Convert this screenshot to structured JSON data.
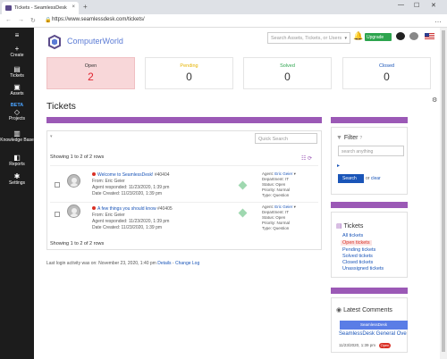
{
  "browser": {
    "tab_title": "Tickets - SeamlessDesk",
    "tab_close": "×",
    "new_tab": "+",
    "url": "https://www.seamlessdesk.com/tickets/",
    "back": "←",
    "forward": "→",
    "reload": "↻",
    "lock": "🔒",
    "menu": "…",
    "minimize": "—",
    "maximize": "☐",
    "close": "✕"
  },
  "sidebar": {
    "items": [
      {
        "label": "Create",
        "icon": "plus-icon",
        "glyph": "+"
      },
      {
        "label": "Tickets",
        "icon": "tickets-icon",
        "glyph": "▤"
      },
      {
        "label": "Assets",
        "icon": "assets-icon",
        "glyph": "▣"
      },
      {
        "label": "Projects",
        "icon": "projects-icon",
        "glyph": "◇",
        "badge": "BETA"
      },
      {
        "label": "Knowledge Base",
        "icon": "book-icon",
        "glyph": "▥"
      },
      {
        "label": "Reports",
        "icon": "reports-icon",
        "glyph": "◧"
      },
      {
        "label": "Settings",
        "icon": "gear-icon",
        "glyph": "✱"
      }
    ]
  },
  "header": {
    "brand": "ComputerWorld",
    "search_placeholder": "Search Assets, Tickets, or Users",
    "search_caret": "▾",
    "bell": "🔔",
    "upgrade_label": "Upgrade"
  },
  "stats": [
    {
      "label": "Open",
      "value": "2",
      "color": "#e0242f"
    },
    {
      "label": "Pending",
      "value": "0",
      "color": "#e5b300"
    },
    {
      "label": "Solved",
      "value": "0",
      "color": "#2da44e"
    },
    {
      "label": "Closed",
      "value": "0",
      "color": "#1a55b8"
    }
  ],
  "page": {
    "title": "Tickets",
    "quick_search_placeholder": "Quick Search",
    "filter_caret": "▾",
    "view_icons": "☷ ⟳",
    "showing_top": "Showing 1 to 2 of 2 rows",
    "showing_bottom": "Showing 1 to 2 of 2 rows"
  },
  "tickets": [
    {
      "title": "Welcome to SeamlessDesk!",
      "number": "#40404",
      "from": "From: Eric Geier",
      "responded": "Agent responded: 11/23/2020, 1:39 pm",
      "created": "Date Created: 11/23/2020, 1:39 pm",
      "agent_label": "Agent:",
      "agent": "Eric Geier",
      "caret": "▾",
      "department": "Department: IT",
      "status": "Status: Open",
      "priority": "Priority: Normal",
      "type": "Type: Question"
    },
    {
      "title": "A few things you should know",
      "number": "#40405",
      "from": "From: Eric Geier",
      "responded": "Agent responded: 11/23/2020, 1:39 pm",
      "created": "Date Created: 11/23/2020, 1:39 pm",
      "agent_label": "Agent:",
      "agent": "Eric Geier",
      "caret": "▾",
      "department": "Department: IT",
      "status": "Status: Open",
      "priority": "Priority: Normal",
      "type": "Type: Question"
    }
  ],
  "footer": {
    "login_note": "Last login activity was on: November 23, 2020, 1:40 pm",
    "details": "Details",
    "separator": " - ",
    "change_log": "Change Log"
  },
  "filter": {
    "title": "Filter",
    "help": "?",
    "input_placeholder": "search anything",
    "button": "Search",
    "or": "or",
    "clear": "clear"
  },
  "ticket_links": {
    "title": "Tickets",
    "items": [
      "All tickets",
      "Open tickets",
      "Pending tickets",
      "Solved tickets",
      "Closed tickets",
      "Unassigned tickets"
    ]
  },
  "comments": {
    "title": "Latest Comments",
    "badge": "SeamlessDesk",
    "item_title": "SeamlessDesk General Ove",
    "item_date": "11/23/2020, 1:39 pm",
    "status": "Open"
  },
  "colors": {
    "accent": "#9b59b6",
    "link": "#1a55b8",
    "sidebar": "#1c1c1c"
  }
}
